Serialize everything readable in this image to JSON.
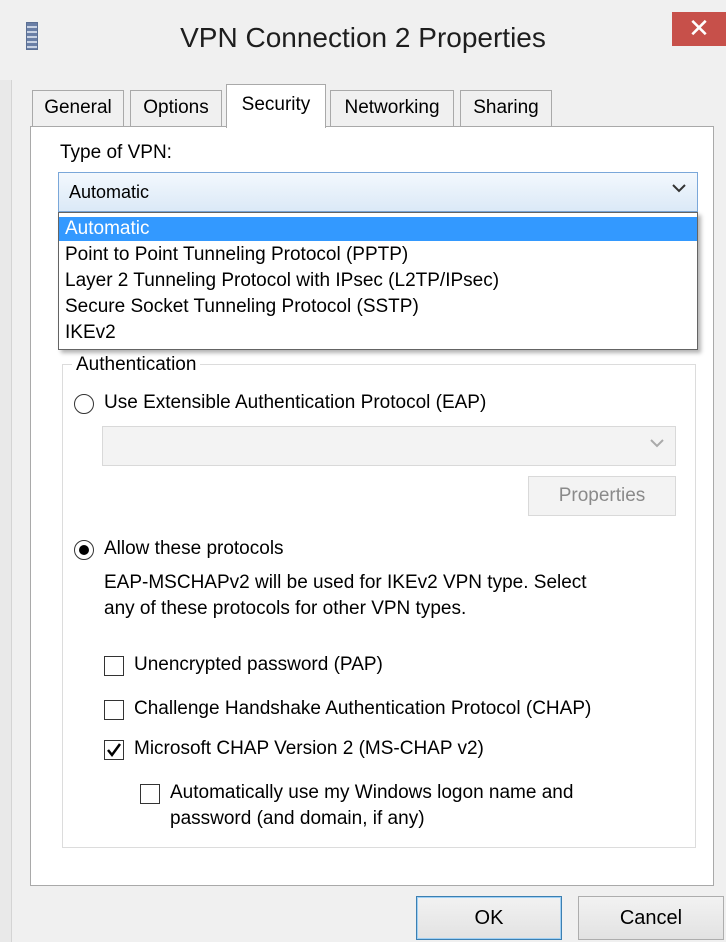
{
  "window": {
    "title": "VPN Connection 2 Properties",
    "close_glyph": "✕"
  },
  "tabs": [
    {
      "label": "General",
      "active": false
    },
    {
      "label": "Options",
      "active": false
    },
    {
      "label": "Security",
      "active": true
    },
    {
      "label": "Networking",
      "active": false
    },
    {
      "label": "Sharing",
      "active": false
    }
  ],
  "vpn_type": {
    "label": "Type of VPN:",
    "selected": "Automatic",
    "options": [
      "Automatic",
      "Point to Point Tunneling Protocol (PPTP)",
      "Layer 2 Tunneling Protocol with IPsec (L2TP/IPsec)",
      "Secure Socket Tunneling Protocol (SSTP)",
      "IKEv2"
    ]
  },
  "authentication": {
    "group_label": "Authentication",
    "eap_radio_label": "Use Extensible Authentication Protocol (EAP)",
    "eap_selected": false,
    "properties_button": "Properties",
    "allow_radio_label": "Allow these protocols",
    "allow_selected": true,
    "note_line1": "EAP-MSCHAPv2 will be used for IKEv2 VPN type. Select",
    "note_line2": "any of these protocols for other VPN types.",
    "protocols": [
      {
        "label": "Unencrypted password (PAP)",
        "checked": false
      },
      {
        "label": "Challenge Handshake Authentication Protocol (CHAP)",
        "checked": false
      },
      {
        "label": "Microsoft CHAP Version 2 (MS-CHAP v2)",
        "checked": true
      }
    ],
    "auto_logon_line1": "Automatically use my Windows logon name and",
    "auto_logon_line2": "password (and domain, if any)",
    "auto_logon_checked": false
  },
  "footer": {
    "ok": "OK",
    "cancel": "Cancel"
  },
  "colors": {
    "selection": "#3399ff",
    "close": "#c7504a"
  },
  "icons": {
    "chevron": "chevron-down-icon",
    "check": "checkmark-icon"
  }
}
